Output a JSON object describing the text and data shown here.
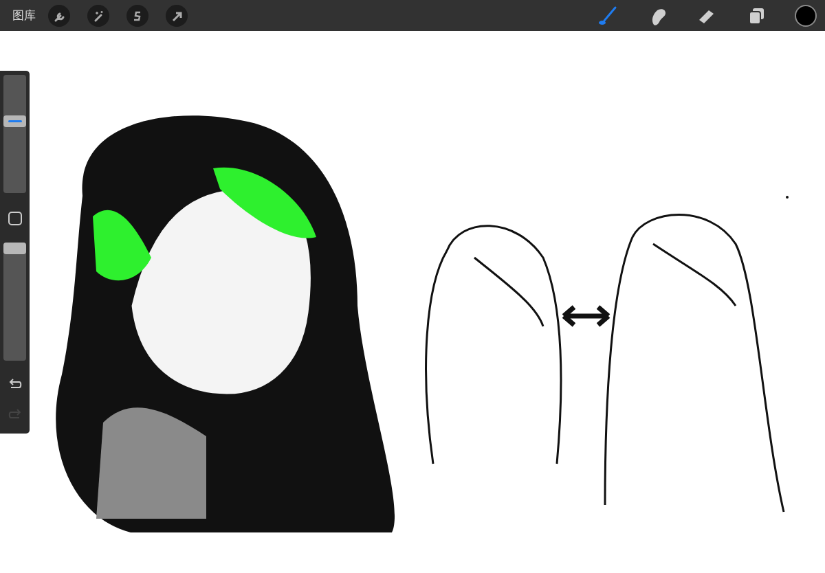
{
  "top_bar": {
    "gallery": "图库",
    "left_tools": [
      {
        "kind": "wrench"
      },
      {
        "kind": "wand"
      },
      {
        "kind": "selection"
      },
      {
        "kind": "transform"
      }
    ],
    "right_tools": [
      {
        "kind": "brush",
        "selected": true
      },
      {
        "kind": "smudge",
        "selected": false
      },
      {
        "kind": "eraser",
        "selected": false
      },
      {
        "kind": "layers",
        "selected": false
      }
    ],
    "current_color": {
      "color": "#000000"
    }
  },
  "sidebar": {
    "brush_size": {
      "level": 0.62
    },
    "opacity": {
      "level": 1
    },
    "undo": {
      "disabled": false
    },
    "redo": {
      "disabled": true
    }
  }
}
